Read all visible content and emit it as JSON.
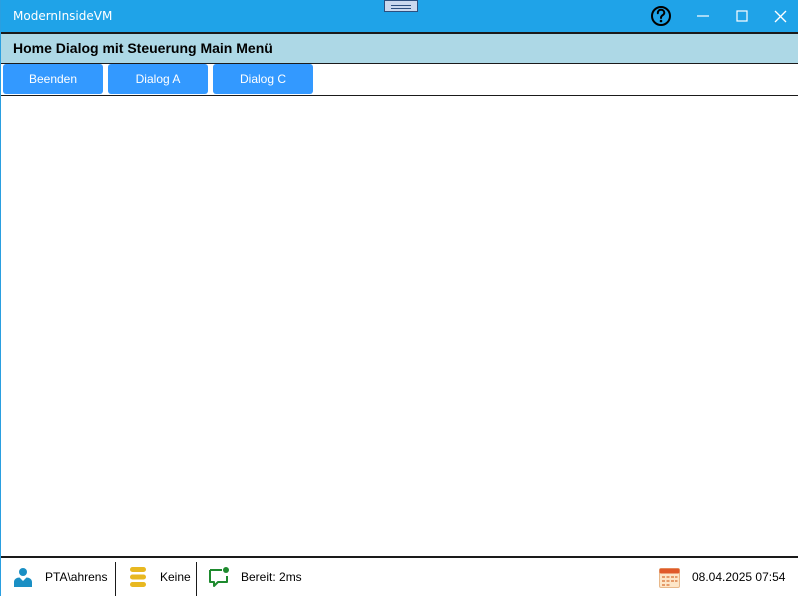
{
  "window": {
    "title": "ModernInsideVM"
  },
  "header": {
    "title": "Home Dialog mit Steuerung Main Menü"
  },
  "menu": {
    "items": [
      {
        "label": "Beenden"
      },
      {
        "label": "Dialog A"
      },
      {
        "label": "Dialog C"
      }
    ]
  },
  "statusbar": {
    "user": "PTA\\ahrens",
    "database": "Keine",
    "status": "Bereit: 2ms",
    "datetime": "08.04.2025 07:54"
  },
  "icons": {
    "user": "user-icon",
    "database": "database-icon",
    "status": "message-icon",
    "calendar": "calendar-icon",
    "help": "help-icon"
  },
  "colors": {
    "titlebar": "#1fa3e8",
    "header": "#add8e6",
    "button": "#3399ff",
    "user_icon": "#1a8fc4",
    "database_icon": "#e8b820",
    "status_icon": "#1e8a2e",
    "calendar_icon": "#e05a2a"
  }
}
